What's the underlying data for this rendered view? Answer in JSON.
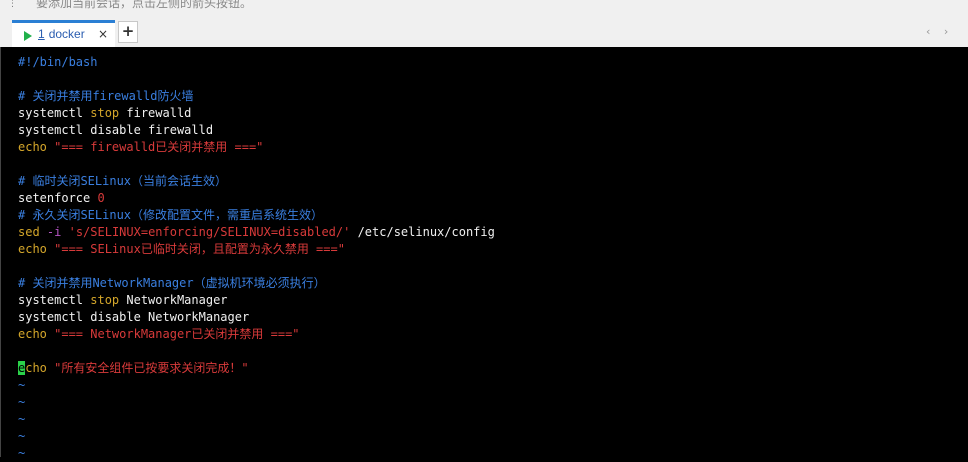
{
  "top_hint": "要添加当前会话，点击左侧的箭头按钮。",
  "tab": {
    "number": "1",
    "name": "docker",
    "close": "×"
  },
  "new_tab": "+",
  "tab_nav": "‹ ›",
  "icons": {
    "status": "running-indicator-icon",
    "close": "close-icon",
    "add": "plus-icon"
  },
  "colors": {
    "comment": "#3a7fe0",
    "keyword": "#d4a62a",
    "string": "#d83a3a",
    "cursor": "#2bd24a",
    "tab_accent": "#2a7fd4"
  },
  "script": {
    "shebang": "#!/bin/bash",
    "c1": "# 关闭并禁用firewalld防火墙",
    "l1_cmd": "systemctl ",
    "l1_kw": "stop",
    "l1_arg": " firewalld",
    "l2": "systemctl disable firewalld",
    "l3_kw": "echo",
    "l3_str": " \"=== firewalld已关闭并禁用 ===\"",
    "c2": "# 临时关闭SELinux（当前会话生效）",
    "l4_cmd": "setenforce ",
    "l4_num": "0",
    "c3": "# 永久关闭SELinux（修改配置文件，需重启系统生效）",
    "l5_kw": "sed",
    "l5_flag": " -i ",
    "l5_str": "'s/SELINUX=enforcing/SELINUX=disabled/'",
    "l5_arg": " /etc/selinux/config",
    "l6_kw": "echo",
    "l6_str": " \"=== SELinux已临时关闭，且配置为永久禁用 ===\"",
    "c4": "# 关闭并禁用NetworkManager（虚拟机环境必须执行）",
    "l7_cmd": "systemctl ",
    "l7_kw": "stop",
    "l7_arg": " NetworkManager",
    "l8": "systemctl disable NetworkManager",
    "l9_kw": "echo",
    "l9_str": " \"=== NetworkManager已关闭并禁用 ===\"",
    "l10_cursor": "e",
    "l10_rest": "cho",
    "l10_str": " \"所有安全组件已按要求关闭完成！\"",
    "tilde": "~"
  }
}
